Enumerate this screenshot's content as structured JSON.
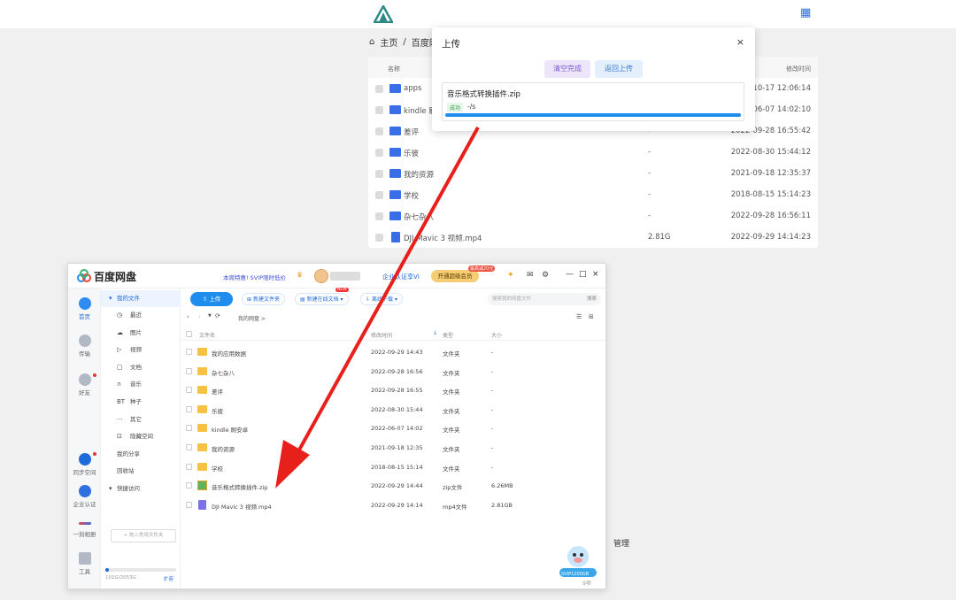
{
  "background": {
    "breadcrumb": {
      "home": "主页",
      "separator": "/",
      "current": "百度网"
    },
    "table_header": {
      "name": "名称",
      "modified": "修改时间"
    },
    "rows": [
      {
        "name": "apps",
        "size": "",
        "time": "7-10-17 12:06:14",
        "type": "folder"
      },
      {
        "name": "kindle 刷",
        "size": "",
        "time": "2-06-07 14:02:10",
        "type": "folder"
      },
      {
        "name": "差评",
        "size": "-",
        "time": "2022-09-28 16:55:42",
        "type": "folder"
      },
      {
        "name": "乐彼",
        "size": "-",
        "time": "2022-08-30 15:44:12",
        "type": "folder"
      },
      {
        "name": "我的资源",
        "size": "-",
        "time": "2021-09-18 12:35:37",
        "type": "folder"
      },
      {
        "name": "学校",
        "size": "-",
        "time": "2018-08-15 15:14:23",
        "type": "folder"
      },
      {
        "name": "杂七杂八",
        "size": "-",
        "time": "2022-09-28 16:56:11",
        "type": "folder"
      },
      {
        "name": "DJI Mavic 3 视频.mp4",
        "size": "2.81G",
        "time": "2022-09-29 14:14:23",
        "type": "video"
      }
    ],
    "manage_label": "管理"
  },
  "upload_dialog": {
    "title": "上传",
    "close": "×",
    "clear_button": "清空完成",
    "back_button": "返回上传",
    "item": {
      "filename": "音乐格式转换插件.zip",
      "status": "成功",
      "path": "-/s",
      "progress": 1.0
    }
  },
  "app": {
    "title": "百度网盘",
    "promo": "本周特惠! SVIP限时低价",
    "enterprise": "企业认证享VI",
    "vip_button": "开通超级会员",
    "vip_tag": "最高减20元",
    "rail": [
      {
        "label": "首页",
        "active": true
      },
      {
        "label": "传输",
        "active": false
      },
      {
        "label": "好友",
        "active": false
      },
      {
        "label": "同步空间",
        "active": false
      },
      {
        "label": "企业认证",
        "active": false
      },
      {
        "label": "一刻相册",
        "active": false
      },
      {
        "label": "工具",
        "active": false
      }
    ],
    "side_nav": {
      "my_files": "我的文件",
      "items": [
        {
          "icon": "◷",
          "label": "最近"
        },
        {
          "icon": "☁",
          "label": "图片"
        },
        {
          "icon": "▷",
          "label": "视频"
        },
        {
          "icon": "▢",
          "label": "文档"
        },
        {
          "icon": "∩",
          "label": "音乐"
        },
        {
          "icon": "BT",
          "label": "种子"
        },
        {
          "icon": "···",
          "label": "其它"
        },
        {
          "icon": "⊡",
          "label": "隐藏空间"
        }
      ],
      "share": "我的分享",
      "recycle": "回收站",
      "quick": "快捷访问",
      "add_common": "+ 拖入常用文件夹",
      "storage": "101G/2053G",
      "storage_used": 0.05,
      "expand": "扩容"
    },
    "toolbar": {
      "upload": "上传",
      "new_folder": "新建文件夹",
      "new_doc": "新建在线文档",
      "new_tag": "NEW",
      "more": "离线下载",
      "search_placeholder": "搜索我的网盘文件",
      "search_button": "搜索"
    },
    "path": "我的网盘 >",
    "columns": {
      "name": "文件名",
      "time": "修改时间",
      "type": "类型",
      "size": "大小"
    },
    "files": [
      {
        "name": "我的应用数据",
        "time": "2022-09-29 14:43",
        "type": "文件夹",
        "size": "-",
        "kind": "folder"
      },
      {
        "name": "杂七杂八",
        "time": "2022-09-28 16:56",
        "type": "文件夹",
        "size": "-",
        "kind": "folder"
      },
      {
        "name": "差评",
        "time": "2022-09-28 16:55",
        "type": "文件夹",
        "size": "-",
        "kind": "folder"
      },
      {
        "name": "乐彼",
        "time": "2022-08-30 15:44",
        "type": "文件夹",
        "size": "-",
        "kind": "folder"
      },
      {
        "name": "kindle 刷安卓",
        "time": "2022-06-07 14:02",
        "type": "文件夹",
        "size": "-",
        "kind": "folder"
      },
      {
        "name": "我的资源",
        "time": "2021-09-18 12:35",
        "type": "文件夹",
        "size": "-",
        "kind": "folder"
      },
      {
        "name": "学校",
        "time": "2018-08-15 15:14",
        "type": "文件夹",
        "size": "-",
        "kind": "folder"
      },
      {
        "name": "音乐格式转换插件.zip",
        "time": "2022-09-29 14:44",
        "type": "zip文件",
        "size": "6.26MB",
        "kind": "zip"
      },
      {
        "name": "DJI Mavic 3 视频.mp4",
        "time": "2022-09-29 14:14",
        "type": "mp4文件",
        "size": "2.81GB",
        "kind": "mp4"
      }
    ],
    "count": "9项",
    "svip_badge": "SVIP1200GB"
  }
}
